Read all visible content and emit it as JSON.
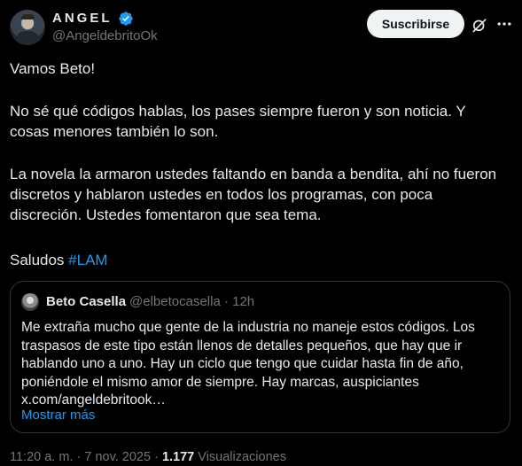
{
  "author": {
    "display_name": "ANGEL",
    "handle": "@AngeldebritoOk",
    "verified_icon": "verified-badge-icon",
    "accent_color": "#1d9bf0"
  },
  "actions": {
    "subscribe_label": "Suscribirse",
    "grok_icon": "grok-icon",
    "more_icon": "more-options-icon"
  },
  "tweet": {
    "paragraph_1": "Vamos Beto!",
    "paragraph_2": "No sé qué códigos hablas, los pases siempre fueron y son noticia. Y cosas menores también lo son.",
    "paragraph_3": "La novela la armaron ustedes faltando en banda a bendita,  ahí no fueron discretos y hablaron ustedes en todos los programas, con poca discreción. Ustedes fomentaron que sea tema.",
    "paragraph_4_prefix": "Saludos ",
    "hashtag": "#LAM"
  },
  "quote": {
    "name": "Beto Casella",
    "handle_time": "@elbetocasella · 12h",
    "lines": [
      "Me extraña mucho que gente de la industria no maneje estos códigos. Los",
      "traspasos de este tipo están llenos de detalles pequeños, que hay que ir",
      "hablando uno a uno. Hay un ciclo que tengo que cuidar hasta fin de año,",
      "poniéndole el mismo amor de siempre. Hay marcas, auspiciantes",
      "x.com/angeldebritook…"
    ],
    "show_more": "Mostrar más"
  },
  "footer": {
    "timestamp": "11:20 a. m. · 7 nov. 2025 · ",
    "views_count": "1.177",
    "views_label": " Visualizaciones"
  }
}
